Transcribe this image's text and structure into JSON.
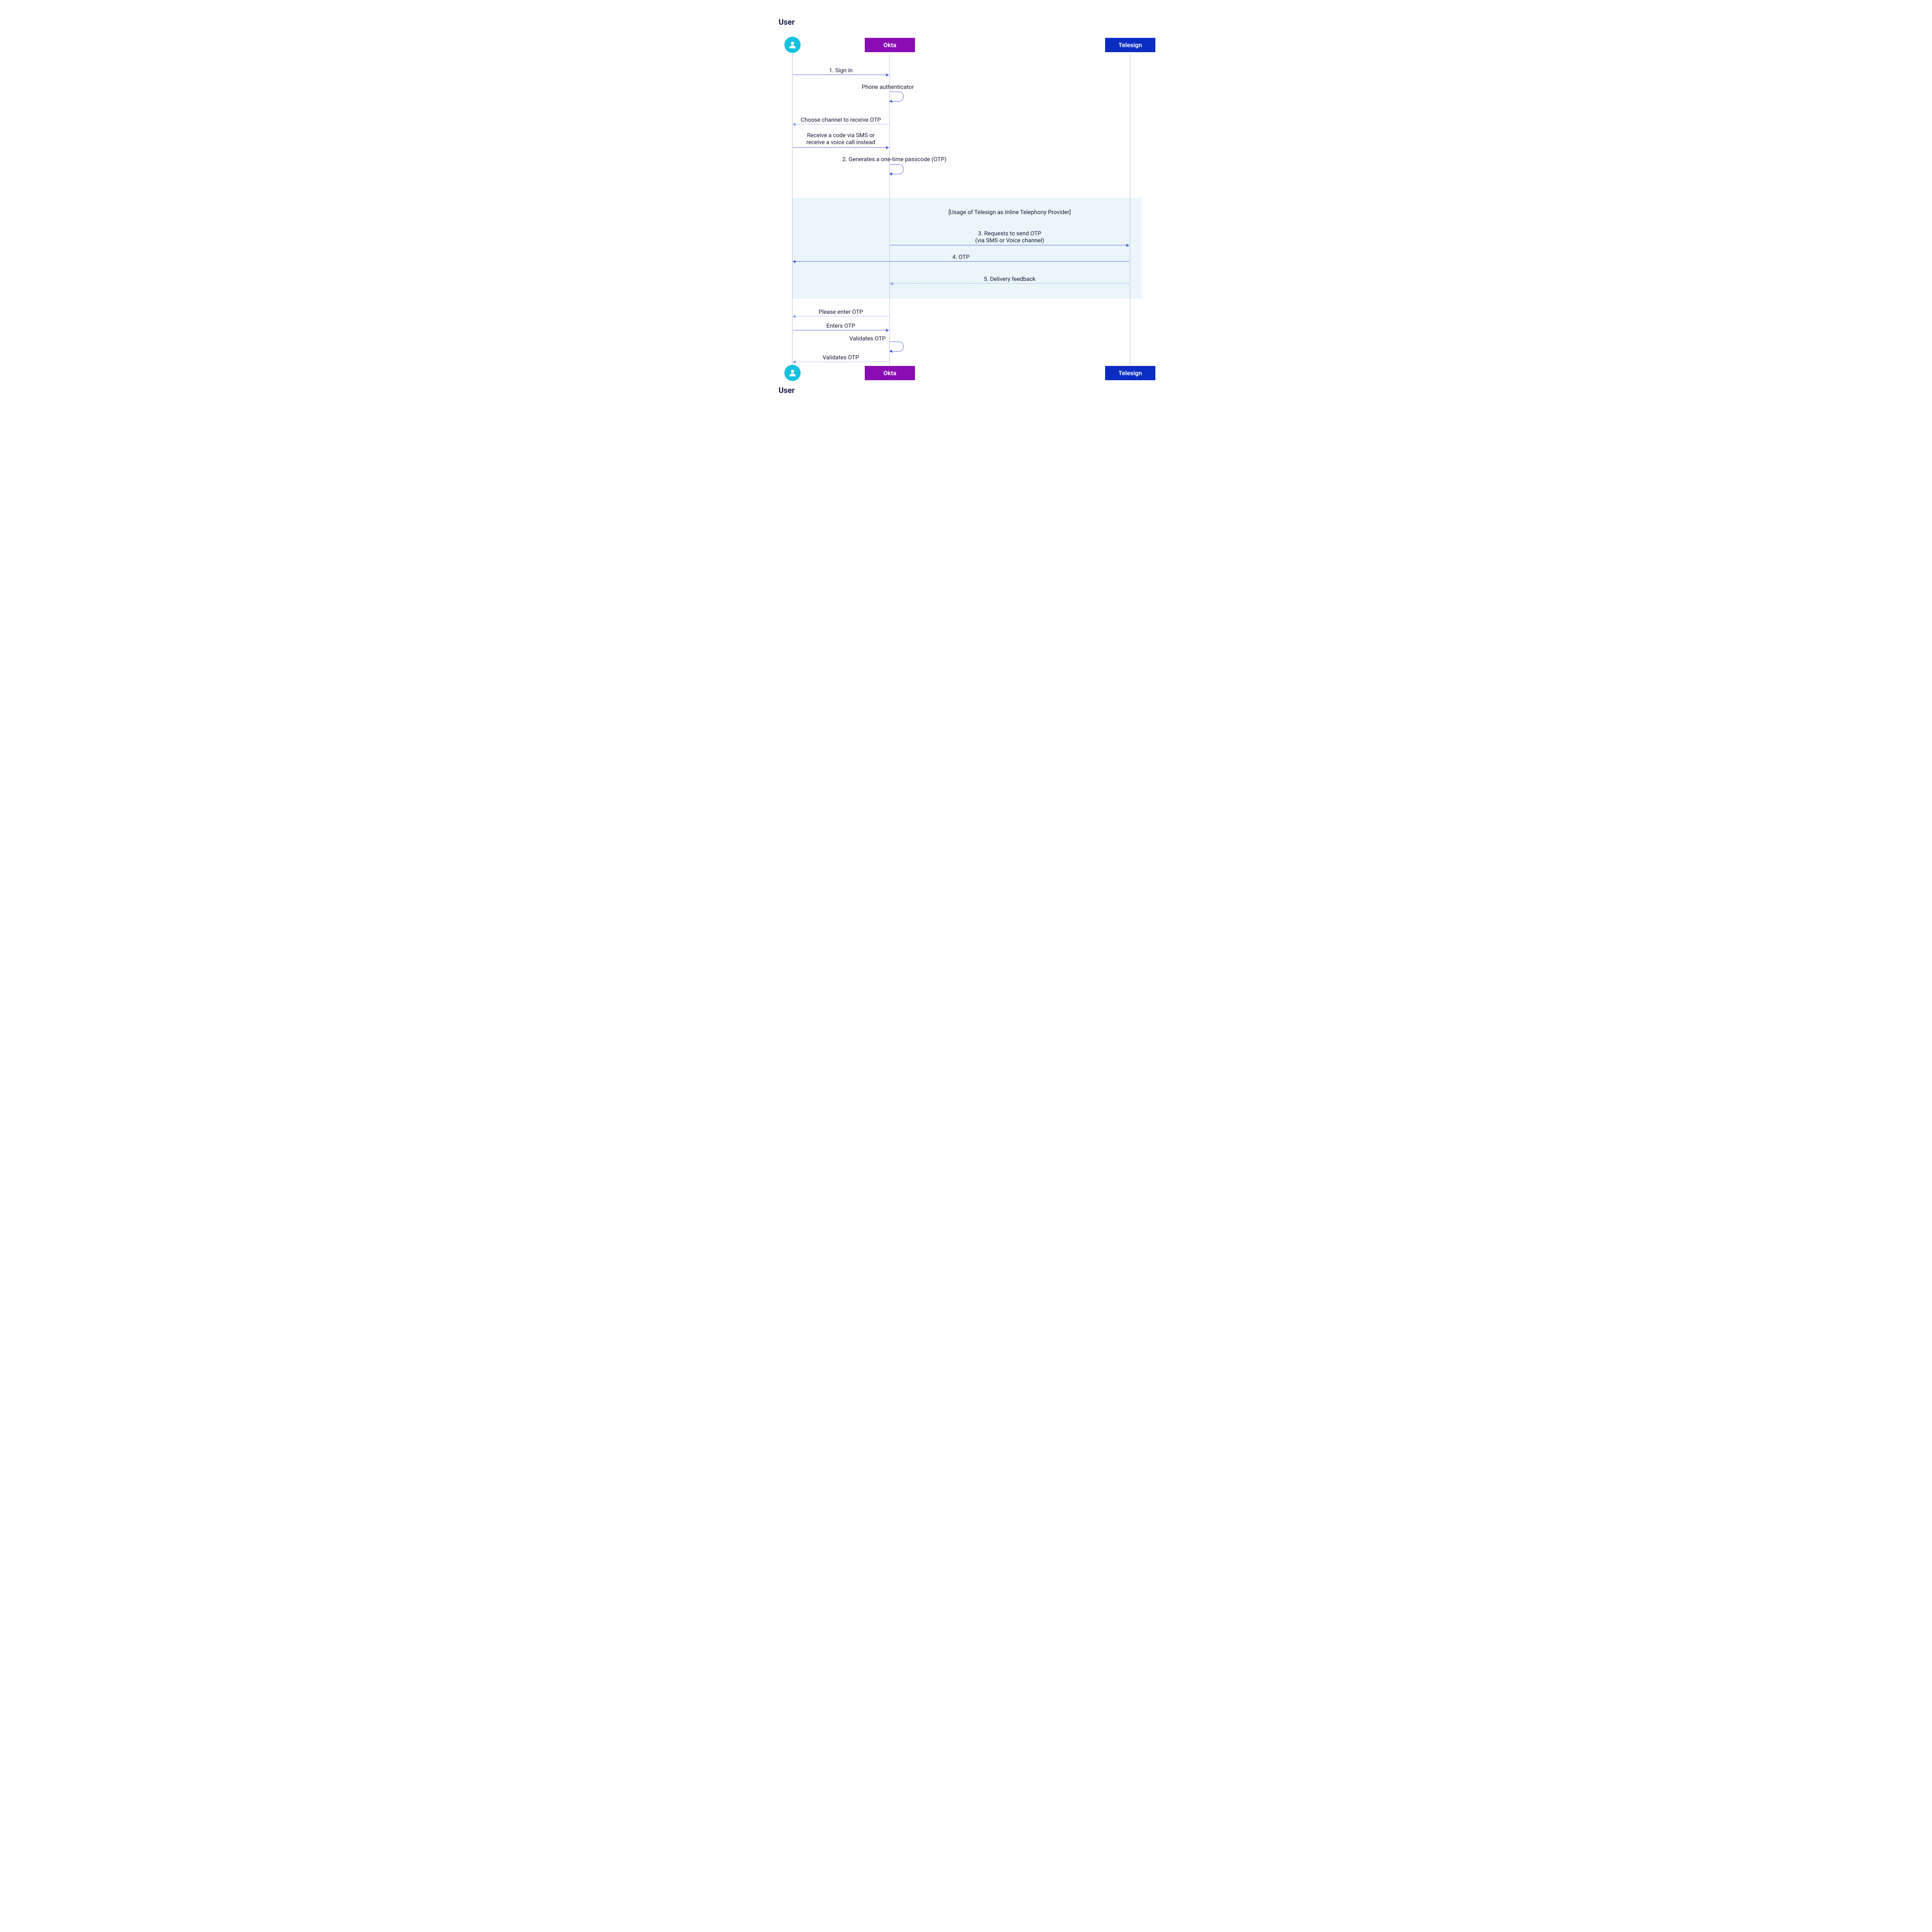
{
  "participants": {
    "user": {
      "label": "User"
    },
    "okta": {
      "label": "Okta",
      "color": "#8a0db3"
    },
    "telesign": {
      "label": "Telesign",
      "color": "#0b2dc4"
    }
  },
  "highlight_title": "[Usage of Telesign as Inline Telephony Provider]",
  "messages": {
    "m1": {
      "text": "1.  Sign in"
    },
    "m2": {
      "text": "Phone authenticator"
    },
    "m3": {
      "text": "Choose channel to receive OTP"
    },
    "m4a": {
      "text": "Receive a code via SMS or"
    },
    "m4b": {
      "text": "receive a voice call instead"
    },
    "m5": {
      "text": "2. Generates a one-time passcode (OTP)"
    },
    "m6a": {
      "text": "3. Requests to send OTP"
    },
    "m6b": {
      "text": "(via SMS or Voice channel)"
    },
    "m7": {
      "text": "4. OTP"
    },
    "m8": {
      "text": "5. Delivery feedback"
    },
    "m9": {
      "text": "Please enter OTP"
    },
    "m10": {
      "text": "Enters OTP"
    },
    "m11": {
      "text": "Validates OTP"
    },
    "m12": {
      "text": "Validates OTP"
    }
  },
  "sequence": [
    {
      "from": "user",
      "to": "okta",
      "style": "solid",
      "label_ref": "m1"
    },
    {
      "from": "okta",
      "to": "okta",
      "style": "self",
      "label_ref": "m2"
    },
    {
      "from": "okta",
      "to": "user",
      "style": "dashed",
      "label_ref": "m3"
    },
    {
      "from": "user",
      "to": "okta",
      "style": "solid",
      "label_ref": "m4a"
    },
    {
      "from": "okta",
      "to": "okta",
      "style": "self",
      "label_ref": "m5"
    },
    {
      "from": "okta",
      "to": "telesign",
      "style": "solid",
      "label_ref": "m6a",
      "group": "highlight"
    },
    {
      "from": "telesign",
      "to": "user",
      "style": "solid",
      "label_ref": "m7",
      "group": "highlight"
    },
    {
      "from": "telesign",
      "to": "okta",
      "style": "dashed",
      "label_ref": "m8",
      "group": "highlight"
    },
    {
      "from": "okta",
      "to": "user",
      "style": "dashed",
      "label_ref": "m9"
    },
    {
      "from": "user",
      "to": "okta",
      "style": "solid",
      "label_ref": "m10"
    },
    {
      "from": "okta",
      "to": "okta",
      "style": "self",
      "label_ref": "m11"
    },
    {
      "from": "okta",
      "to": "user",
      "style": "dashed",
      "label_ref": "m12"
    }
  ]
}
